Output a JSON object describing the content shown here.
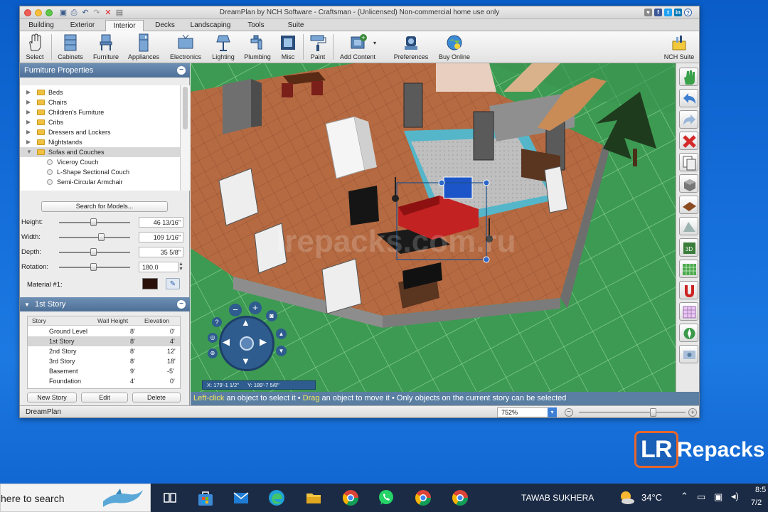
{
  "window": {
    "title": "DreamPlan by NCH Software - Craftsman - (Unlicensed) Non-commercial home use only"
  },
  "menu_tabs": [
    "Building",
    "Exterior",
    "Interior",
    "Decks",
    "Landscaping",
    "Tools",
    "Suite"
  ],
  "active_tab": "Interior",
  "toolbar": {
    "select": "Select",
    "cabinets": "Cabinets",
    "furniture": "Furniture",
    "appliances": "Appliances",
    "electronics": "Electronics",
    "lighting": "Lighting",
    "plumbing": "Plumbing",
    "misc": "Misc",
    "paint": "Paint",
    "add_content": "Add Content",
    "preferences": "Preferences",
    "buy_online": "Buy Online",
    "nch_suite": "NCH Suite"
  },
  "furniture_panel": {
    "title": "Furniture Properties",
    "tree": [
      {
        "label": "Beds",
        "expanded": false
      },
      {
        "label": "Chairs",
        "expanded": false
      },
      {
        "label": "Children's Furniture",
        "expanded": false
      },
      {
        "label": "Cribs",
        "expanded": false
      },
      {
        "label": "Dressers and Lockers",
        "expanded": false
      },
      {
        "label": "Nightstands",
        "expanded": false
      },
      {
        "label": "Sofas and Couches",
        "expanded": true
      }
    ],
    "sub_items": [
      "Viceroy Couch",
      "L-Shape Sectional Couch",
      "Semi-Circular Armchair"
    ],
    "search_button": "Search for Models...",
    "height_label": "Height:",
    "height_value": "46 13/16\"",
    "width_label": "Width:",
    "width_value": "109 1/16\"",
    "depth_label": "Depth:",
    "depth_value": "35 5/8\"",
    "rotation_label": "Rotation:",
    "rotation_value": "180.0",
    "material_label": "Material #1:"
  },
  "story_panel": {
    "title": "1st Story",
    "headers": [
      "Story",
      "Wall Height",
      "Elevation"
    ],
    "rows": [
      {
        "story": "Ground Level",
        "wall_height": "8'",
        "elevation": "0'"
      },
      {
        "story": "1st Story",
        "wall_height": "8'",
        "elevation": "4'"
      },
      {
        "story": "2nd Story",
        "wall_height": "8'",
        "elevation": "12'"
      },
      {
        "story": "3rd Story",
        "wall_height": "8'",
        "elevation": "18'"
      },
      {
        "story": "Basement",
        "wall_height": "9'",
        "elevation": "-5'"
      },
      {
        "story": "Foundation",
        "wall_height": "4'",
        "elevation": "0'"
      }
    ],
    "new_story": "New Story",
    "edit": "Edit",
    "delete": "Delete"
  },
  "viewport": {
    "coord_x": "X: 179'-1 1/2\"",
    "coord_y": "Y: 189'-7 5/8\"",
    "status_pre": "Left-click",
    "status_mid1": " an object to select it • ",
    "status_drag": "Drag",
    "status_mid2": " an object to move it • Only objects on the current story can be selected"
  },
  "bottom": {
    "app_name": "DreamPlan",
    "zoom": "752%"
  },
  "watermark": "lrepacks.com.ru",
  "brand_logo": "Repacks",
  "taskbar": {
    "search_placeholder": "here to search",
    "user": "TAWAB SUKHERA",
    "temperature": "34°C",
    "time": "8:5",
    "date": "7/2"
  },
  "colors": {
    "panel_header": "#5a7fa2",
    "floor": "#b86a44",
    "grass": "#3c9650",
    "accent_yellow": "#f3e65a"
  }
}
